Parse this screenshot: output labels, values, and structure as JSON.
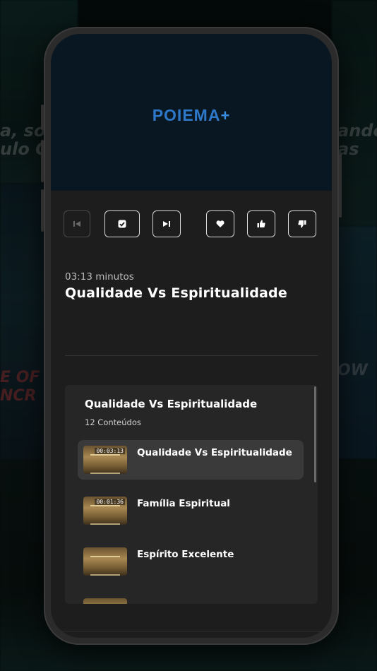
{
  "background": {
    "left_text": "a, sou\nulo Co",
    "right_text": "ando\nas",
    "left_text_2": "E OF\nNCR",
    "right_text_2": "OW"
  },
  "header": {
    "logo_text": "POIEMA",
    "logo_suffix": "+"
  },
  "controls": {
    "prev_icon": "skip-back-icon",
    "check_icon": "check-icon",
    "next_icon": "skip-forward-icon",
    "favorite_icon": "heart-icon",
    "like_icon": "thumbs-up-icon",
    "dislike_icon": "thumbs-down-icon"
  },
  "episode": {
    "duration": "03:13 minutos",
    "title": "Qualidade Vs Espiritualidade"
  },
  "playlist": {
    "title": "Qualidade Vs Espiritualidade",
    "count": "12 Conteúdos",
    "items": [
      {
        "title": "Qualidade Vs Espiritualidade",
        "duration": "00:03:13"
      },
      {
        "title": "Família Espiritual",
        "duration": "00:01:36"
      },
      {
        "title": "Espírito Excelente",
        "duration": ""
      }
    ]
  },
  "colors": {
    "accent_blue": "#2d78c8",
    "header_bg": "#091722",
    "screen_bg": "#1d1d1d",
    "panel_bg": "#262626",
    "active_item_bg": "#3a3a3a"
  }
}
